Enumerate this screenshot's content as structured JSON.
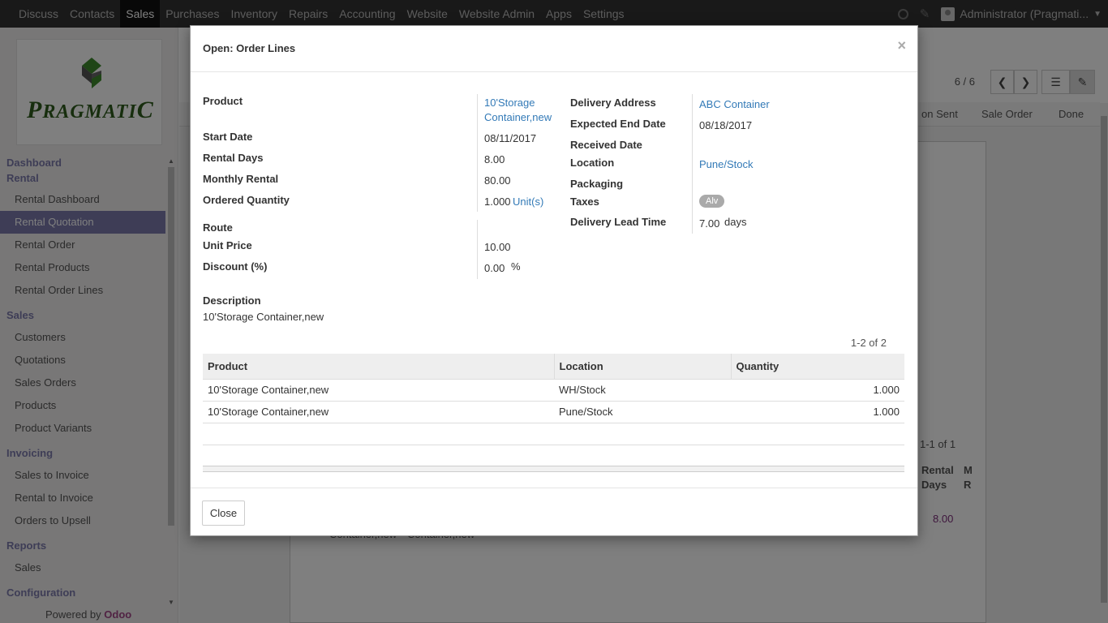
{
  "navbar": {
    "menu": [
      "Discuss",
      "Contacts",
      "Sales",
      "Purchases",
      "Inventory",
      "Repairs",
      "Accounting",
      "Website",
      "Website Admin",
      "Apps",
      "Settings"
    ],
    "active": "Sales",
    "user": "Administrator (Pragmati..."
  },
  "logo": {
    "text_big": "P",
    "text_rest": "RAGMATI",
    "text_end": "C"
  },
  "sidebar": {
    "sections": [
      {
        "title": "Dashboard",
        "items": []
      },
      {
        "title": "Rental",
        "items": [
          "Rental Dashboard",
          "Rental Quotation",
          "Rental Order",
          "Rental Products",
          "Rental Order Lines"
        ]
      },
      {
        "title": "Sales",
        "items": [
          "Customers",
          "Quotations",
          "Sales Orders",
          "Products",
          "Product Variants"
        ]
      },
      {
        "title": "Invoicing",
        "items": [
          "Sales to Invoice",
          "Rental to Invoice",
          "Orders to Upsell"
        ]
      },
      {
        "title": "Reports",
        "items": [
          "Sales"
        ]
      },
      {
        "title": "Configuration",
        "items": []
      }
    ],
    "active_item": "Rental Quotation",
    "powered_by": "Powered by",
    "powered_brand": "Odoo"
  },
  "background": {
    "pager": "6 / 6",
    "stages": [
      "on Sent",
      "Sale Order",
      "Done"
    ],
    "list_pager": "1-1 of 1",
    "col_rental": "Rental",
    "col_days": "Days",
    "col_m": "M",
    "col_r": "R",
    "days_value": "8.00",
    "row_text_1": "Container,new",
    "row_text_2": "Container,new"
  },
  "modal": {
    "title": "Open: Order Lines",
    "left_fields": {
      "product_label": "Product",
      "product_value_line1": "10'Storage",
      "product_value_line2": "Container,new",
      "start_date_label": "Start Date",
      "start_date_value": "08/11/2017",
      "rental_days_label": "Rental Days",
      "rental_days_value": "8.00",
      "monthly_rental_label": "Monthly Rental",
      "monthly_rental_value": "80.00",
      "ordered_qty_label": "Ordered Quantity",
      "ordered_qty_value": "1.000",
      "ordered_qty_unit": "Unit(s)",
      "route_label": "Route",
      "unit_price_label": "Unit Price",
      "unit_price_value": "10.00",
      "discount_label": "Discount (%)",
      "discount_value": "0.00",
      "discount_unit": "%"
    },
    "right_fields": {
      "delivery_address_label": "Delivery Address",
      "delivery_address_value": "ABC Container",
      "expected_end_label": "Expected End Date",
      "expected_end_value": "08/18/2017",
      "received_date_label": "Received Date",
      "location_label": "Location",
      "location_value": "Pune/Stock",
      "packaging_label": "Packaging",
      "taxes_label": "Taxes",
      "taxes_tag": "Alv",
      "lead_time_label": "Delivery Lead Time",
      "lead_time_value": "7.00",
      "lead_time_unit": "days"
    },
    "description_label": "Description",
    "description_value": "10'Storage Container,new",
    "pager": "1-2 of 2",
    "table": {
      "headers": [
        "Product",
        "Location",
        "Quantity"
      ],
      "rows": [
        [
          "10'Storage Container,new",
          "WH/Stock",
          "1.000"
        ],
        [
          "10'Storage Container,new",
          "Pune/Stock",
          "1.000"
        ]
      ]
    },
    "close_label": "Close"
  }
}
